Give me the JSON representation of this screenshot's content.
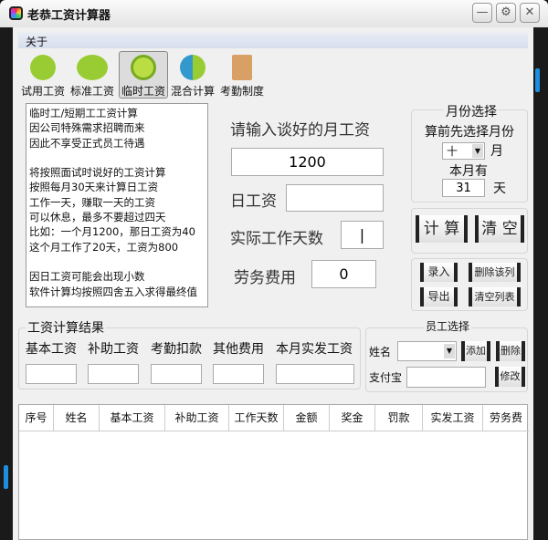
{
  "window": {
    "title": "老恭工资计算器",
    "minimize": "—",
    "settings": "⚙",
    "close": "✕"
  },
  "menu": {
    "about": "关于"
  },
  "toolbar": [
    {
      "label": "试用工资",
      "icon": "person-icon"
    },
    {
      "label": "标准工资",
      "icon": "group-icon"
    },
    {
      "label": "临时工资",
      "icon": "clock-icon"
    },
    {
      "label": "混合计算",
      "icon": "users-icon"
    },
    {
      "label": "考勤制度",
      "icon": "clipboard-icon"
    }
  ],
  "notes": "临时工/短期工工资计算\n因公司特殊需求招聘而来\n因此不享受正式员工待遇\n\n将按照面试时说好的工资计算\n按照每月30天来计算日工资\n工作一天，赚取一天的工资\n可以休息，最多不要超过四天\n比如：一个月1200，那日工资为40\n这个月工作了20天，工资为800\n\n因日工资可能会出现小数\n软件计算均按照四舍五入求得最终值",
  "form": {
    "prompt": "请输入谈好的月工资",
    "monthly": "1200",
    "daily_label": "日工资",
    "daily": "",
    "days_label": "实际工作天数",
    "days": "|",
    "labor_label": "劳务费用",
    "labor": "0"
  },
  "month": {
    "title": "月份选择",
    "hint": "算前先选择月份",
    "value": "十",
    "unit": "月",
    "has_label": "本月有",
    "days": "31",
    "days_unit": "天"
  },
  "actions": {
    "calc": "计 算",
    "clear": "清 空",
    "record": "录入",
    "delete_col": "删除该列",
    "export": "导出",
    "clear_list": "清空列表"
  },
  "result": {
    "title": "工资计算结果",
    "fields": [
      "基本工资",
      "补助工资",
      "考勤扣款",
      "其他费用",
      "本月实发工资"
    ]
  },
  "employee": {
    "title": "员工选择",
    "name_label": "姓名",
    "add": "添加",
    "delete": "删除",
    "alipay_label": "支付宝",
    "modify": "修改"
  },
  "table": {
    "columns": [
      "序号",
      "姓名",
      "基本工资",
      "补助工资",
      "工作天数",
      "金额",
      "奖金",
      "罚款",
      "实发工资",
      "劳务费"
    ]
  }
}
